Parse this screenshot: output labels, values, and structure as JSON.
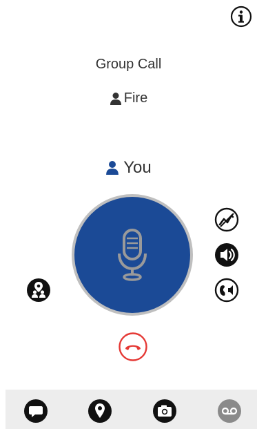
{
  "header": {
    "info_icon": "info-icon"
  },
  "call": {
    "title": "Group Call",
    "group_name": "Fire",
    "speaker_name": "You"
  },
  "controls": {
    "ptt_icon": "microphone-icon",
    "right_icons": [
      "signal-icon",
      "speaker-icon",
      "earpiece-icon"
    ],
    "left_icon": "map-people-icon",
    "end_call_icon": "phone-hangup-icon"
  },
  "bottom_bar": {
    "icons": [
      "chat-icon",
      "location-pin-icon",
      "camera-icon",
      "voicemail-icon"
    ]
  },
  "colors": {
    "ptt_blue": "#1b4a96",
    "end_call_red": "#e53935",
    "icon_black": "#111111",
    "disabled_gray": "#8a8a8a",
    "bar_bg": "#ededed"
  }
}
